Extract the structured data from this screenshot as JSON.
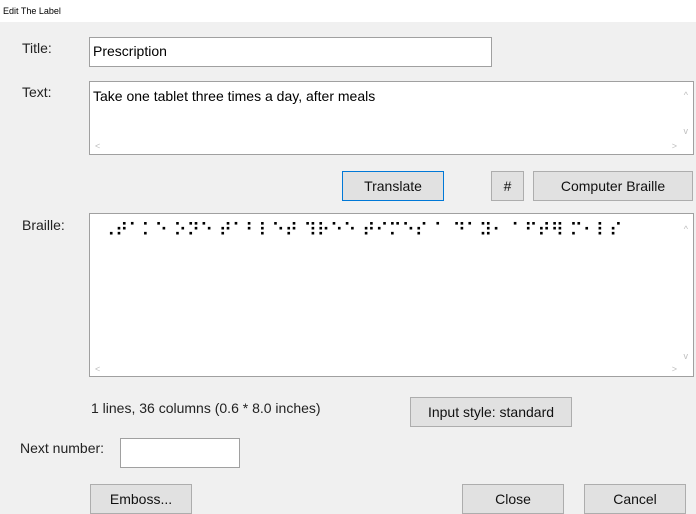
{
  "window": {
    "title": "Edit The Label"
  },
  "form": {
    "title_label": "Title:",
    "title_value": "Prescription",
    "text_label": "Text:",
    "text_value": "Take one tablet three times a day, after meals",
    "braille_label": "Braille:",
    "braille_value": "⠠⠞⠁⠅⠑ ⠕⠝⠑ ⠞⠁⠃⠇⠑⠞ ⠹⠗⠑⠑ ⠞⠊⠍⠑⠎ ⠁ ⠙⠁⠽⠂ ⠁⠋⠞⠻ ⠍⠂⠇⠎",
    "braille_info": "1 lines, 36 columns (0.6 * 8.0 inches)",
    "next_number_label": "Next number:",
    "next_number_value": ""
  },
  "buttons": {
    "translate": "Translate",
    "hash": "#",
    "computer_braille": "Computer Braille",
    "input_style": "Input style: standard",
    "emboss": "Emboss...",
    "close": "Close",
    "cancel": "Cancel"
  },
  "icons": {
    "scroll_up": "^",
    "scroll_down": "v",
    "scroll_left": "<",
    "scroll_right": ">"
  }
}
